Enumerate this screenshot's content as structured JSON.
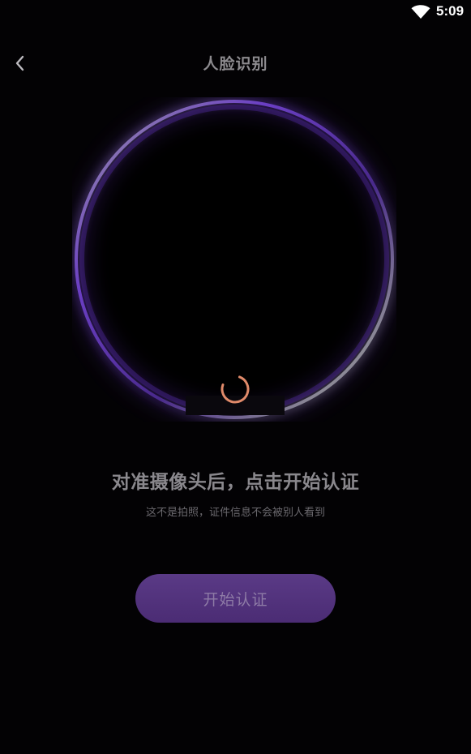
{
  "status_bar": {
    "time": "5:09",
    "wifi_icon": "wifi-icon"
  },
  "header": {
    "title": "人脸识别",
    "back_icon": "chevron-left-icon"
  },
  "camera": {
    "ring_color": "#7a3fd0",
    "spinner_color": "#e08a6a",
    "spinner_icon": "loading-spinner-icon"
  },
  "instructions": {
    "title": "对准摄像头后，点击开始认证",
    "subtitle": "这不是拍照，证件信息不会被别人看到"
  },
  "start_button": {
    "label": "开始认证",
    "color": "#523379"
  }
}
